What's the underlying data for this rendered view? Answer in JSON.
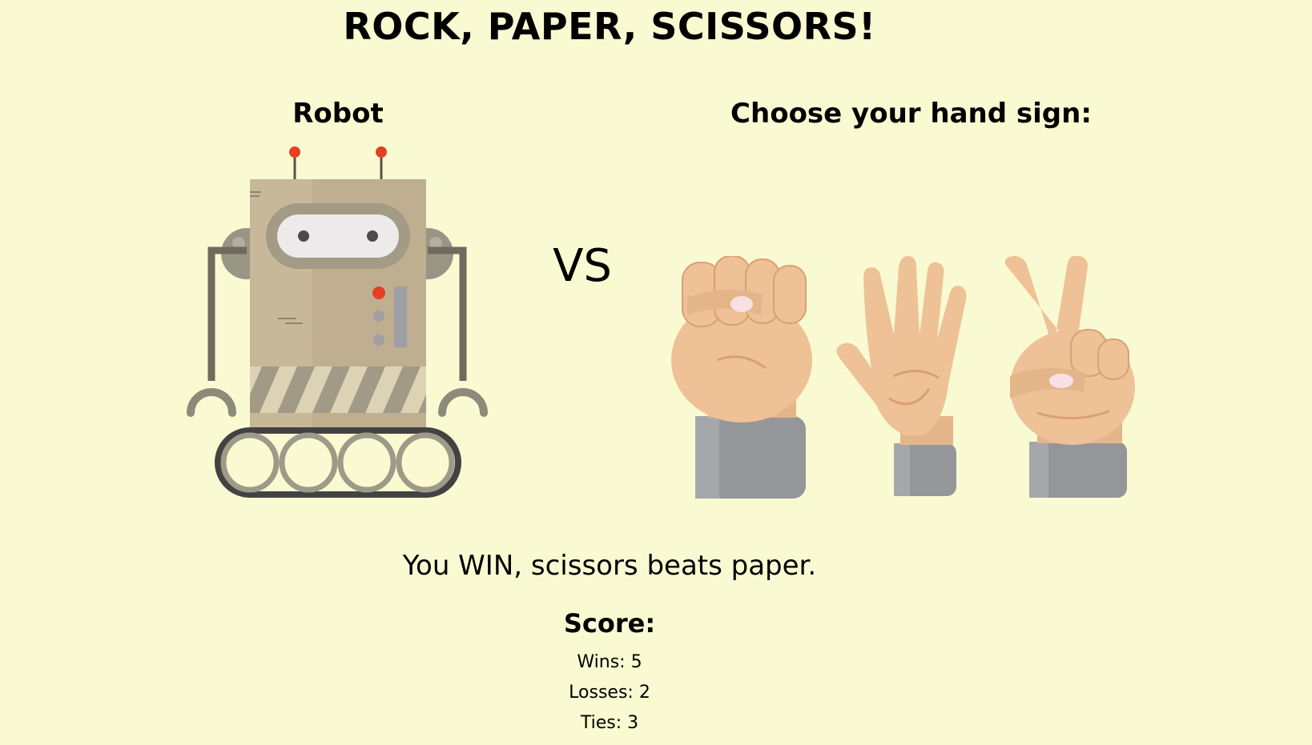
{
  "page": {
    "title": "ROCK, PAPER, SCISSORS!",
    "robot_label": "Robot",
    "vs_label": "VS",
    "choose_label": "Choose your hand sign:",
    "result_text": "You WIN, scissors beats paper."
  },
  "hands": [
    {
      "name": "rock",
      "icon": "fist-hand-icon"
    },
    {
      "name": "paper",
      "icon": "open-hand-icon"
    },
    {
      "name": "scissors",
      "icon": "peace-hand-icon"
    }
  ],
  "score": {
    "title": "Score:",
    "wins_label": "Wins: ",
    "wins": "5",
    "losses_label": "Losses: ",
    "losses": "2",
    "ties_label": "Ties: ",
    "ties": "3"
  },
  "colors": {
    "background": "#fafad2",
    "skin": "#eec196",
    "sleeve": "#95969a",
    "robot_body": "#c8b89a",
    "robot_light": "#e53f24"
  }
}
